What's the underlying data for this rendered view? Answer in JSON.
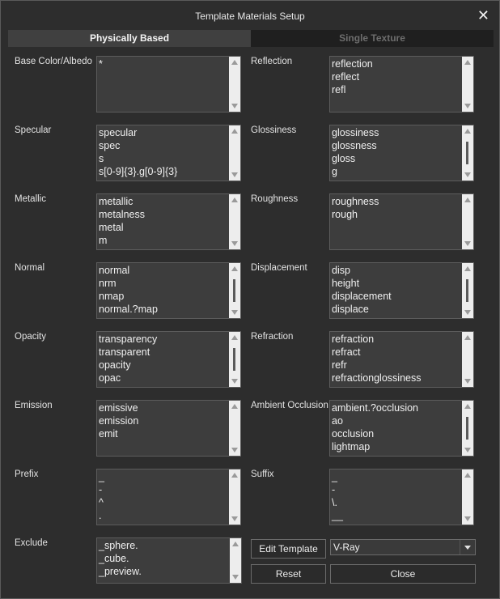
{
  "window": {
    "title": "Template Materials Setup",
    "close_glyph": "✕"
  },
  "tabs": [
    {
      "label": "Physically Based",
      "active": true
    },
    {
      "label": "Single Texture",
      "active": false
    }
  ],
  "fields": {
    "base_color": {
      "label": "Base Color/Albedo",
      "items": [
        "*"
      ]
    },
    "reflection": {
      "label": "Reflection",
      "items": [
        "reflection",
        "reflect",
        "refl"
      ]
    },
    "specular": {
      "label": "Specular",
      "items": [
        "specular",
        "spec",
        "s",
        "s[0-9]{3}.g[0-9]{3}"
      ]
    },
    "glossiness": {
      "label": "Glossiness",
      "items": [
        "glossiness",
        "glossness",
        "gloss",
        "g"
      ]
    },
    "metallic": {
      "label": "Metallic",
      "items": [
        "metallic",
        "metalness",
        "metal",
        "m"
      ]
    },
    "roughness": {
      "label": "Roughness",
      "items": [
        "roughness",
        "rough"
      ]
    },
    "normal": {
      "label": "Normal",
      "items": [
        "normal",
        "nrm",
        "nmap",
        "normal.?map"
      ]
    },
    "displacement": {
      "label": "Displacement",
      "items": [
        "disp",
        "height",
        "displacement",
        "displace"
      ]
    },
    "opacity": {
      "label": "Opacity",
      "items": [
        "transparency",
        "transparent",
        "opacity",
        "opac"
      ]
    },
    "refraction": {
      "label": "Refraction",
      "items": [
        "refraction",
        "refract",
        "refr",
        "refractionglossiness"
      ]
    },
    "emission": {
      "label": "Emission",
      "items": [
        "emissive",
        "emission",
        "emit"
      ]
    },
    "ambient_occlusion": {
      "label": "Ambient Occlusion",
      "items": [
        "ambient.?occlusion",
        "ao",
        "occlusion",
        "lightmap"
      ]
    },
    "prefix": {
      "label": "Prefix",
      "items": [
        "_",
        "-",
        "^",
        "."
      ]
    },
    "suffix": {
      "label": "Suffix",
      "items": [
        "_",
        "-",
        "\\.",
        "__"
      ]
    },
    "exclude": {
      "label": "Exclude",
      "items": [
        "_sphere.",
        "_cube.",
        "_preview."
      ]
    }
  },
  "buttons": {
    "edit_template": "Edit Template",
    "reset": "Reset",
    "close": "Close"
  },
  "renderer_select": {
    "value": "V-Ray"
  },
  "colors": {
    "background": "#2d2d2d",
    "listbox": "#3d3d3d",
    "scrollbar": "#ededed"
  }
}
